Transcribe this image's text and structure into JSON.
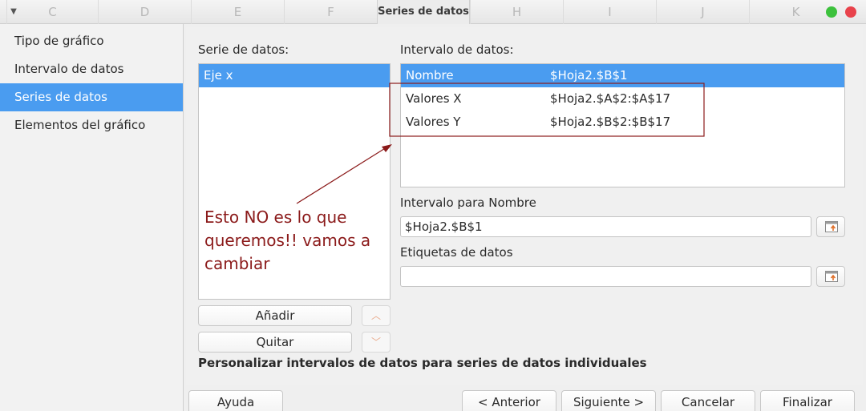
{
  "window": {
    "title": "Series de datos",
    "columns": [
      "C",
      "D",
      "E",
      "F",
      "H",
      "I",
      "J",
      "K"
    ]
  },
  "sidebar": {
    "items": [
      {
        "label": "Tipo de gráfico",
        "active": false
      },
      {
        "label": "Intervalo de datos",
        "active": false
      },
      {
        "label": "Series de datos",
        "active": true
      },
      {
        "label": "Elementos del gráfico",
        "active": false
      }
    ]
  },
  "series_panel": {
    "label": "Serie de datos:",
    "items": [
      "Eje x"
    ],
    "add_label": "Añadir",
    "remove_label": "Quitar"
  },
  "ranges_panel": {
    "label": "Intervalo de datos:",
    "rows": [
      {
        "role": "Nombre",
        "range": "$Hoja2.$B$1"
      },
      {
        "role": "Valores X",
        "range": "$Hoja2.$A$2:$A$17"
      },
      {
        "role": "Valores Y",
        "range": "$Hoja2.$B$2:$B$17"
      }
    ]
  },
  "name_range": {
    "label": "Intervalo para Nombre",
    "value": "$Hoja2.$B$1"
  },
  "data_labels": {
    "label": "Etiquetas de datos",
    "value": ""
  },
  "hint": "Personalizar intervalos de datos para series de datos individuales",
  "annotation": {
    "text": "Esto NO es lo que queremos!! vamos a cambiar",
    "color": "#8b1a1a"
  },
  "footer": {
    "help": "Ayuda",
    "back": "< Anterior",
    "next": "Siguiente >",
    "cancel": "Cancelar",
    "finish": "Finalizar"
  },
  "colors": {
    "accent": "#4a9cf0",
    "annotation": "#8b1a1a"
  }
}
